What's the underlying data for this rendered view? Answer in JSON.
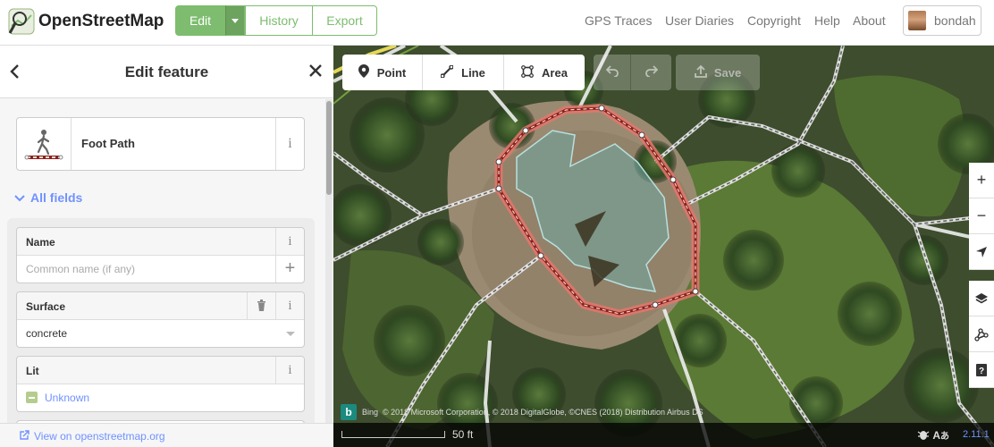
{
  "header": {
    "brand": "OpenStreetMap",
    "edit_label": "Edit",
    "history_label": "History",
    "export_label": "Export",
    "nav": [
      "GPS Traces",
      "User Diaries",
      "Copyright",
      "Help",
      "About"
    ],
    "username": "bondah",
    "accent_color": "#7ebc6f"
  },
  "sidebar": {
    "title": "Edit feature",
    "preset": {
      "name": "Foot Path",
      "icon": "pedestrian-footpath-icon"
    },
    "all_fields_label": "All fields",
    "fields": [
      {
        "label": "Name",
        "placeholder": "Common name (if any)"
      },
      {
        "label": "Surface",
        "value": "concrete"
      },
      {
        "label": "Lit",
        "value": "Unknown"
      }
    ],
    "footer_link": "View on openstreetmap.org"
  },
  "map": {
    "toolbar": {
      "point": "Point",
      "line": "Line",
      "area": "Area",
      "save": "Save"
    },
    "attribution_source": "Bing",
    "attribution": "© 2018 Microsoft Corporation, © 2018 DigitalGlobe, ©CNES (2018) Distribution Airbus DS",
    "scale": "50 ft",
    "version": "2.11.1",
    "controls": [
      "zoom-in-icon",
      "zoom-out-icon",
      "geolocate-icon",
      "layers-icon",
      "map-data-icon",
      "help-icon"
    ]
  }
}
